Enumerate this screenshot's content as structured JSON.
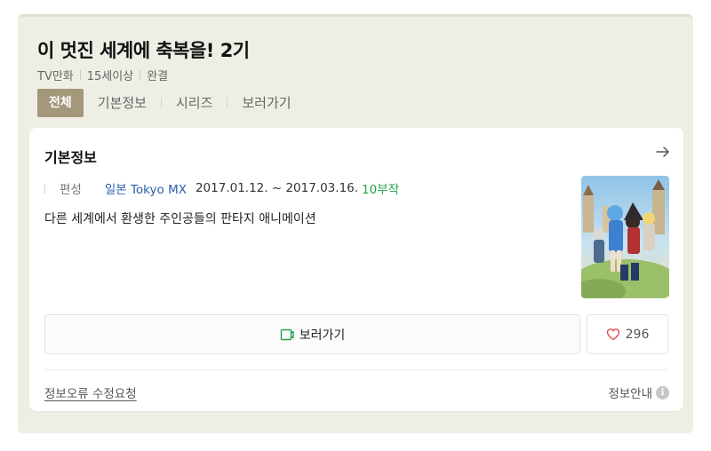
{
  "header": {
    "title": "이 멋진 세계에 축복을! 2기",
    "meta": [
      "TV만화",
      "15세이상",
      "완결"
    ]
  },
  "tabs": [
    {
      "label": "전체",
      "active": true
    },
    {
      "label": "기본정보",
      "active": false
    },
    {
      "label": "시리즈",
      "active": false
    },
    {
      "label": "보러가기",
      "active": false
    }
  ],
  "info_card": {
    "title": "기본정보",
    "arrow_icon": "arrow-right-icon",
    "broadcast_label": "편성",
    "broadcaster": "일본 Tokyo MX",
    "dates": "2017.01.12. ~ 2017.03.16.",
    "episodes": "10부작",
    "description": "다른 세계에서 환생한 주인공들의 판타지 애니메이션",
    "watch_label": "보러가기",
    "like_count": "296",
    "report_label": "정보오류 수정요청",
    "info_label": "정보안내",
    "info_symbol": "i"
  },
  "colors": {
    "accent": "#a4977a",
    "link": "#2a5daa",
    "episodes": "#21a348",
    "watch_icon": "#21a348",
    "like_icon": "#e04a4a"
  }
}
